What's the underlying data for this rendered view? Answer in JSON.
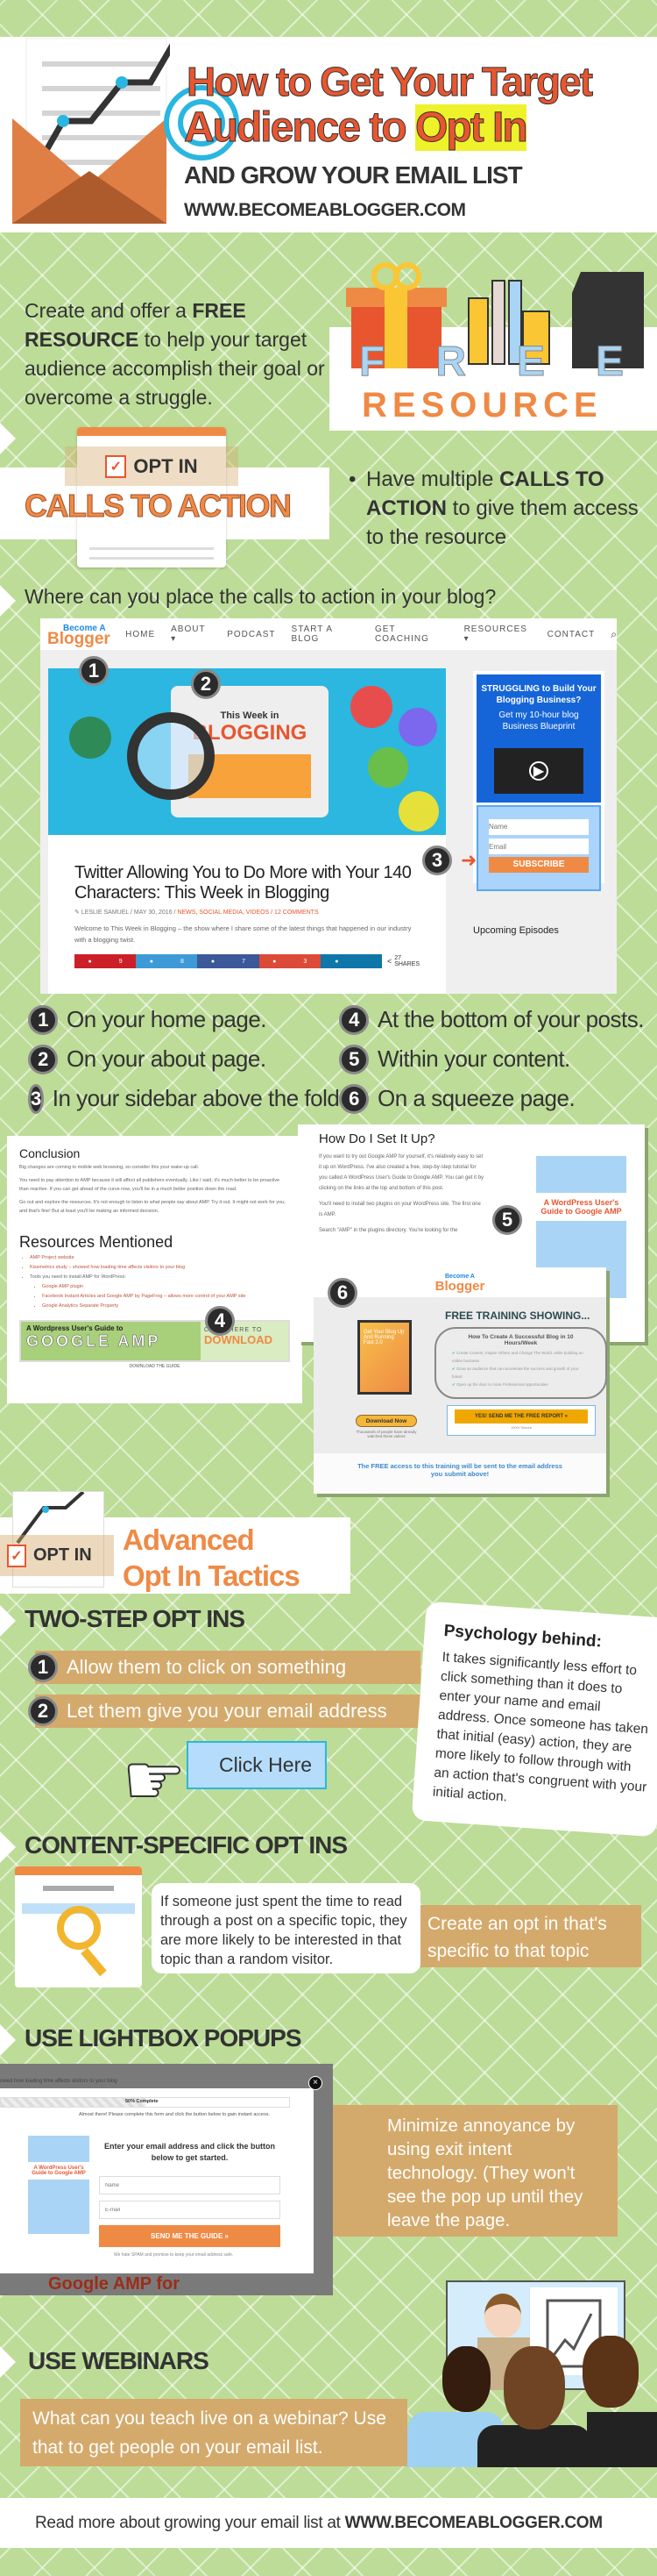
{
  "header": {
    "title_line1": "How to Get Your Target",
    "title_line2_prefix": "Audience to ",
    "title_line2_highlight": "Opt In",
    "subtitle": "AND GROW YOUR EMAIL LIST",
    "url": "WWW.BECOMEABLOGGER.COM"
  },
  "free_resource": {
    "text_pre": "Create and offer a ",
    "text_bold": "FREE RESOURCE",
    "text_post": " to help your target audience accomplish their goal or overcome a struggle.",
    "graphic_word1": "FREE",
    "graphic_word2": "RESOURCE"
  },
  "calls_to_action": {
    "badge": "OPT IN",
    "banner": "CALLS TO ACTION",
    "bullet_pre": "Have multiple ",
    "bullet_bold": "CALLS TO ACTION",
    "bullet_post": " to give them access to the resource"
  },
  "placement": {
    "question": "Where can you place the calls to action in your blog?",
    "site": {
      "logo_top": "Become A",
      "logo": "Blogger",
      "nav": [
        "HOME",
        "ABOUT ▾",
        "PODCAST",
        "START A BLOG",
        "GET COACHING",
        "RESOURCES ▾",
        "CONTACT"
      ],
      "hero_small": "This Week in",
      "hero_big": "BLOGGING",
      "post_title": "Twitter Allowing You to Do More with Your 140 Characters: This Week in Blogging",
      "meta_author": "LESLIE SAMUEL",
      "meta_date": "MAY 30, 2016",
      "meta_cats": "NEWS, SOCIAL MEDIA, VIDEOS",
      "meta_comments": "12 COMMENTS",
      "excerpt": "Welcome to This Week in Blogging – the show where I share some of the latest things that happened in our industry with a blogging twist.",
      "shares": [
        {
          "icon": "pinterest",
          "count": "9",
          "color": "#cb2027"
        },
        {
          "icon": "twitter",
          "count": "8",
          "color": "#3d9ad6"
        },
        {
          "icon": "facebook",
          "count": "7",
          "color": "#3b5998"
        },
        {
          "icon": "google-plus",
          "count": "3",
          "color": "#dc4a38"
        },
        {
          "icon": "linkedin",
          "count": "",
          "color": "#0e76a8"
        }
      ],
      "share_total": "27",
      "share_label": "SHARES",
      "sidebar_headline": "STRUGGLING to Build Your Blogging Business?",
      "sidebar_sub": "Get my 10-hour blog Business Blueprint",
      "name_placeholder": "Name",
      "email_placeholder": "Email",
      "subscribe": "SUBSCRIBE",
      "upcoming": "Upcoming Episodes"
    },
    "markers": [
      "1",
      "2",
      "3"
    ],
    "list": [
      {
        "n": "1",
        "text": "On your home page."
      },
      {
        "n": "2",
        "text": "On your about page."
      },
      {
        "n": "3",
        "text": "In your sidebar above the fold"
      },
      {
        "n": "4",
        "text": "At the bottom of your posts."
      },
      {
        "n": "5",
        "text": "Within your content."
      },
      {
        "n": "6",
        "text": "On a squeeze page."
      }
    ]
  },
  "examples": {
    "conclusion": {
      "title": "Conclusion",
      "p1": "Big changes are coming to mobile web browsing, so consider this your wake-up call.",
      "p2": "You need to pay attention to AMP because it will affect all publishers eventually. Like I said, it's much better to be proactive than reactive. If you can get ahead of the curve now, you'll be in a much better position down the road.",
      "p3": "Go out and explore the resources. It's not enough to listen to what people say about AMP. Try it out. It might not work for you, and that's fine! But at least you'll be making an informed decision.",
      "resources_title": "Resources Mentioned",
      "resources": [
        "AMP Project website",
        "Kissmetrics study – showed how loading time affects visitors to your blog",
        "Tools you need to install AMP for WordPress:",
        "Google AMP plugin",
        "Facebook Instant Articles and Google AMP by PageFrog – allows more control of your AMP site",
        "Google Analytics Separate Property"
      ],
      "banner_top": "A Wordpress User's Guide to",
      "banner_big": "GOOGLE AMP",
      "banner_cta1": "CLICK HERE TO",
      "banner_cta2": "DOWNLOAD",
      "banner_caption": "DOWNLOAD THE GUIDE",
      "marker": "4"
    },
    "setup": {
      "title": "How Do I Set It Up?",
      "p1": "If you want to try out Google AMP for yourself, it's relatively easy to set it up on WordPress. I've also created a free, step-by-step tutorial for you called A WordPress User's Guide to Google AMP. You can get it by clicking on the links at the top and bottom of this post.",
      "p2": "You'll need to install two plugins on your WordPress site. The first one is AMP.",
      "p3": "Search \"AMP\" in the plugins directory. You're looking for the",
      "book": "A WordPress User's Guide to Google AMP",
      "marker": "5"
    },
    "squeeze": {
      "logo_top": "Become A",
      "logo": "Blogger",
      "heading": "FREE TRAINING SHOWING...",
      "box_title": "How To Create A Successful Blog in 10 Hours/Week",
      "bullets": [
        "Create Content, Inspire Others and Change The World, while building an online business",
        "Grow an audience that can accelerate the success and growth of your brand",
        "Open up the door to more Professional opportunities"
      ],
      "dvd": "Get Your Blog Up And Running Fast 2.0",
      "download": "Download Now",
      "download_note": "Thousands of people have already watched these videos",
      "cta": "YES! SEND ME THE FREE REPORT »",
      "secure": "100% Secure",
      "footer": "The FREE access to this training will be sent to the email address you submit above!",
      "marker": "6"
    }
  },
  "advanced": {
    "badge": "OPT IN",
    "title1": "Advanced",
    "title2": "Opt In Tactics"
  },
  "two_step": {
    "heading": "TWO-STEP OPT INS",
    "steps": [
      {
        "n": "1",
        "text": "Allow them to click on something"
      },
      {
        "n": "2",
        "text": "Let them give you your email address"
      }
    ],
    "button": "Click Here",
    "psych_title": "Psychology behind:",
    "psych_text": "It takes significantly less effort to click something than it does to enter your name and email address. Once someone has taken that initial (easy) action, they are more likely to follow through with an action that's congruent with your initial action."
  },
  "content_specific": {
    "heading": "CONTENT-SPECIFIC OPT INS",
    "bubble": "If someone just spent the time to read through a post on a specific topic, they are more likely to be interested in that topic than a random visitor.",
    "callout": "Create an opt in that's specific to that topic"
  },
  "lightbox": {
    "heading": "USE LIGHTBOX POPUPS",
    "bg_text": "owed how loading time affects visitors to your blog",
    "progress": "50% Complete",
    "progress_value": 50,
    "notice": "Almost there! Please complete this form and click the button below to gain instant access.",
    "headline": "Enter your email address and click the button below to get started.",
    "name_placeholder": "Name",
    "email_placeholder": "E-mail",
    "button": "SEND ME THE GUIDE »",
    "spam": "We hate SPAM and promise to keep your email address safe.",
    "book": "A WordPress User's Guide to Google AMP",
    "bg_title": "Google AMP for",
    "callout": "Minimize annoyance by using exit intent technology. (They won't see the pop up until they leave the page."
  },
  "webinars": {
    "heading": "USE WEBINARS",
    "callout": "What can you teach live on a webinar? Use that to get people on your email list."
  },
  "footer": {
    "text": "Read more about growing your email list at ",
    "url": "WWW.BECOMEABLOGGER.COM"
  },
  "colors": {
    "background": "#bcdc97",
    "orange": "#e8562f",
    "accent_orange": "#ef8a45",
    "tan": "#d4aa6c",
    "blue": "#1565d8",
    "highlight": "#eef22a"
  }
}
